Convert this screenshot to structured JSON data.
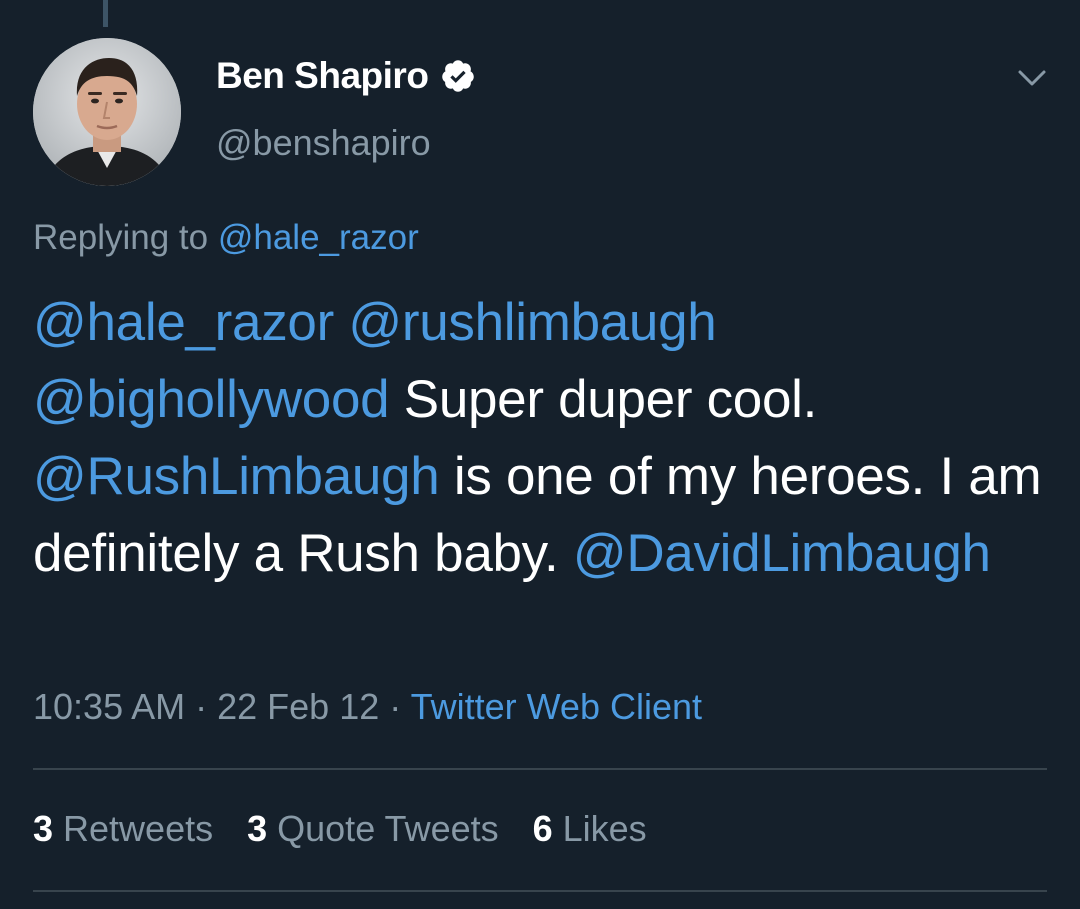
{
  "tweet": {
    "author": {
      "display_name": "Ben Shapiro",
      "handle": "@benshapiro",
      "verified": true,
      "avatar_icon": "avatar-photo"
    },
    "replying": {
      "prefix": "Replying to",
      "to": "@hale_razor"
    },
    "text": [
      {
        "type": "mention",
        "value": "@hale_razor"
      },
      {
        "type": "text",
        "value": " "
      },
      {
        "type": "mention",
        "value": "@rushlimbaugh"
      },
      {
        "type": "text",
        "value": " "
      },
      {
        "type": "mention",
        "value": "@bighollywood"
      },
      {
        "type": "text",
        "value": " Super duper cool. "
      },
      {
        "type": "mention",
        "value": "@RushLimbaugh"
      },
      {
        "type": "text",
        "value": " is one of my heroes. I am definitely a Rush baby. "
      },
      {
        "type": "mention",
        "value": "@DavidLimbaugh"
      }
    ],
    "meta": {
      "time": "10:35 AM",
      "separator": " · ",
      "date": "22 Feb 12",
      "source": "Twitter Web Client"
    },
    "stats": {
      "retweets_count": "3",
      "retweets_label": "Retweets",
      "quotes_count": "3",
      "quotes_label": "Quote Tweets",
      "likes_count": "6",
      "likes_label": "Likes"
    }
  },
  "colors": {
    "background": "#15202b",
    "link": "#4c9ae0",
    "secondary_text": "#8899a6",
    "divider": "#38444d"
  }
}
